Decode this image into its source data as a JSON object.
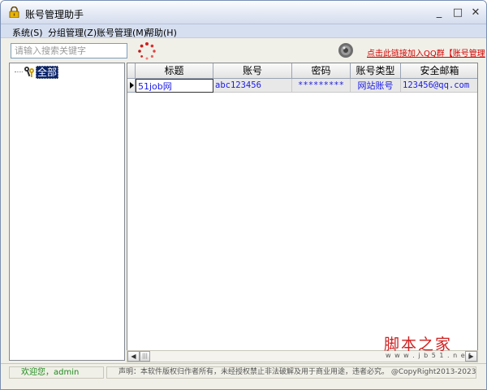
{
  "window": {
    "title": "账号管理助手",
    "minimize_glyph": "_",
    "maximize_glyph": "□",
    "close_glyph": "✕"
  },
  "menu": {
    "items": [
      {
        "label": "系统(S)"
      },
      {
        "label": "分组管理(Z)"
      },
      {
        "label": "账号管理(M)"
      },
      {
        "label": "帮助(H)"
      }
    ]
  },
  "toolbar": {
    "search_placeholder": "请输入搜索关键字",
    "qq_link": "点击此链接加入QQ群【账号管理"
  },
  "tree": {
    "root_label": "全部"
  },
  "grid": {
    "columns": [
      "标题",
      "账号",
      "密码",
      "账号类型",
      "安全邮箱"
    ],
    "rows": [
      {
        "title": "51job网",
        "account": "abc123456",
        "password": "*********",
        "type": "网站账号",
        "email": "123456@qq.com"
      }
    ]
  },
  "status": {
    "user": "欢迎您，admin",
    "note": "声明：本软件版权归作者所有，未经授权禁止非法破解及用于商业用途，违者必究。  @CopyRight2013-2023"
  },
  "watermark": {
    "main": "脚本之家",
    "sub": "w w w . j b 5 1 . n e t"
  },
  "colors": {
    "accent": "#0a246a",
    "link": "#d40000",
    "cell_text": "#1a1ae6",
    "status_user": "#1a8a1a"
  },
  "icons": {
    "app": "lock-icon",
    "spinner": "loading-spinner-icon",
    "speaker": "speaker-icon",
    "tree_root": "keys-icon"
  }
}
